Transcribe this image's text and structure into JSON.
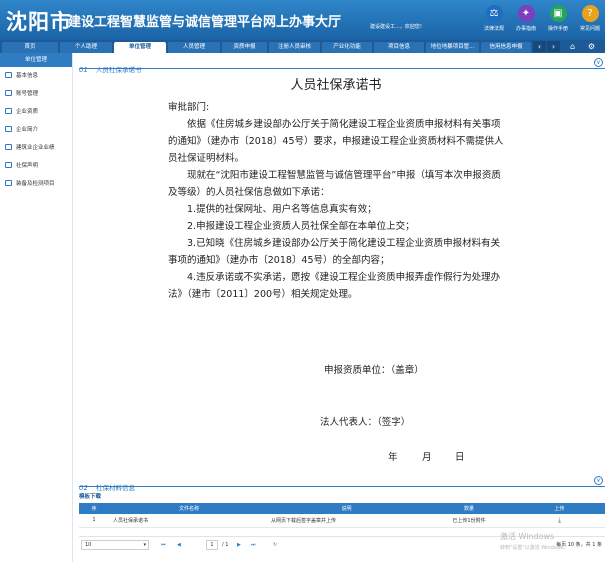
{
  "header": {
    "city": "沈阳市",
    "title": "建设工程智慧监管与诚信管理平台网上办事大厅",
    "welcome": "建设建设工...，欢迎您！",
    "buttons": [
      {
        "label": "法律法规",
        "icon": "scale-icon",
        "color": "#1c6fc0"
      },
      {
        "label": "办事指南",
        "icon": "compass-icon",
        "color": "#7b3fbf"
      },
      {
        "label": "操作手册",
        "icon": "book-icon",
        "color": "#24a35a"
      },
      {
        "label": "常见问题",
        "icon": "question-icon",
        "color": "#e7a21f"
      }
    ]
  },
  "nav": {
    "tabs": [
      "首页",
      "个人助理",
      "单位管理",
      "人员管理",
      "资质申报",
      "注册人员审核",
      "产业化功能",
      "项目信息",
      "地位地暴项目管...",
      "信用信息申报"
    ],
    "active": "单位管理",
    "prev": "‹",
    "next": "›",
    "home_icon": "⌂",
    "settings_icon": "⚙"
  },
  "sidebar": {
    "header": "单位管理",
    "items": [
      "基本信息",
      "账号管理",
      "企业资质",
      "企业简介",
      "建筑业企业业绩",
      "社保声明",
      "装备及检测项目"
    ]
  },
  "section1": {
    "num": "01",
    "title": "人员社保承诺书"
  },
  "document": {
    "title": "人员社保承诺书",
    "salutation": "审批部门:",
    "para1": "依据《住房城乡建设部办公厅关于简化建设工程企业资质申报材料有关事项的通知》（建办市〔2018〕45号）要求，申报建设工程企业资质材料不需提供人员社保证明材料。",
    "para2": "现就在“沈阳市建设工程智慧监管与诚信管理平台”申报（填写本次申报资质及等级）的人员社保信息做如下承诺：",
    "item1": "1.提供的社保网址、用户名等信息真实有效；",
    "item2": "2.申报建设工程企业资质人员社保全部在本单位上交；",
    "item3": "3.已知晓《住房城乡建设部办公厅关于简化建设工程企业资质申报材料有关事项的通知》（建办市〔2018〕45号）的全部内容；",
    "item4": "4.违反承诺或不实承诺，愿按《建设工程企业资质申报弄虚作假行为处理办法》（建市〔2011〕200号）相关规定处理。",
    "unit": "申报资质单位：（盖章）",
    "rep": "法人代表人：（签字）",
    "date_year": "年",
    "date_month": "月",
    "date_day": "日"
  },
  "section2": {
    "num": "02",
    "title": "社保材料信息"
  },
  "template_download": "模板下载",
  "table": {
    "headers": [
      "序",
      "文件名称",
      "说明",
      "数量",
      "上传"
    ],
    "rows": [
      {
        "no": "1",
        "name": "人员社保承诺书",
        "desc": "从网页下载后签字盖章并上传",
        "count": "已上传1份附件",
        "upload_icon": "download-icon"
      }
    ]
  },
  "pager": {
    "page_size": "10",
    "first": "⏮",
    "prev": "◀",
    "current": "1",
    "total": "/ 1",
    "next": "▶",
    "last": "⏭",
    "refresh": "↻",
    "info": "每页 10 条，共 1 条"
  },
  "watermark": {
    "line1": "激活 Windows",
    "line2": "转到\"设置\"以激活 Windows。"
  }
}
